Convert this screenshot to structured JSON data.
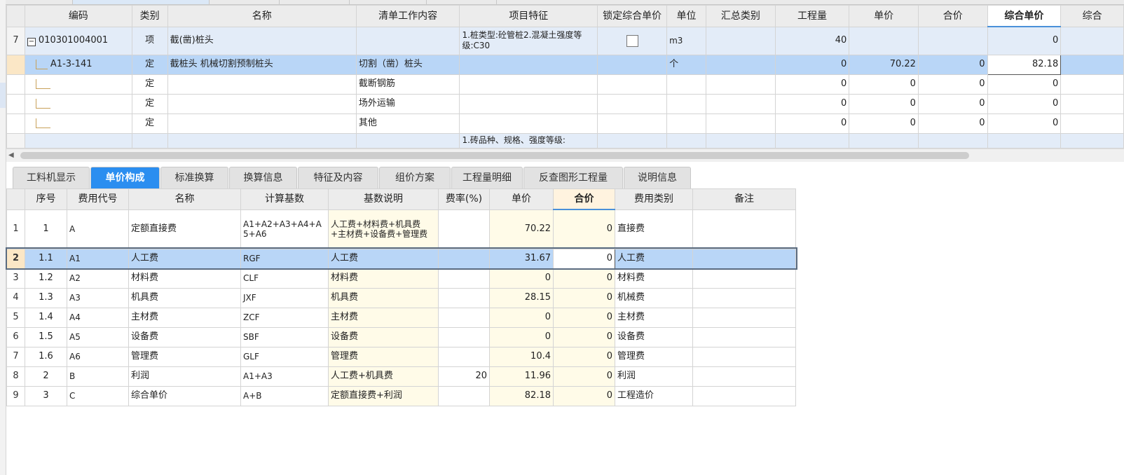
{
  "upper": {
    "headers": [
      "编码",
      "类别",
      "名称",
      "清单工作内容",
      "项目特征",
      "锁定综合单价",
      "单位",
      "汇总类别",
      "工程量",
      "单价",
      "合价",
      "综合单价",
      "综合"
    ],
    "bill_row": {
      "row_no": "7",
      "code": "010301004001",
      "type": "项",
      "name": "截(凿)桩头",
      "content": "",
      "feature": "1.桩类型:砼管桩2.混凝土强度等级:C30",
      "unit": "m3",
      "summary": "",
      "qty": "40",
      "price": "",
      "total": "",
      "unit_price": "0",
      "extra": ""
    },
    "child_rows": [
      {
        "row_no": "",
        "code": "A1-3-141",
        "type": "定",
        "name": "截桩头 机械切割预制桩头",
        "content": "切割（凿）桩头",
        "feature": "",
        "unit": "个",
        "summary": "",
        "qty": "0",
        "price": "70.22",
        "total": "0",
        "unit_price": "82.18"
      },
      {
        "row_no": "",
        "code": "",
        "type": "定",
        "name": "",
        "content": "截断钢筋",
        "feature": "",
        "unit": "",
        "summary": "",
        "qty": "0",
        "price": "0",
        "total": "0",
        "unit_price": "0"
      },
      {
        "row_no": "",
        "code": "",
        "type": "定",
        "name": "",
        "content": "场外运输",
        "feature": "",
        "unit": "",
        "summary": "",
        "qty": "0",
        "price": "0",
        "total": "0",
        "unit_price": "0"
      },
      {
        "row_no": "",
        "code": "",
        "type": "定",
        "name": "",
        "content": "其他",
        "feature": "",
        "unit": "",
        "summary": "",
        "qty": "0",
        "price": "0",
        "total": "0",
        "unit_price": "0"
      }
    ],
    "cut_row": {
      "feature": "1.砖品种、规格、强度等级:"
    }
  },
  "tabs": [
    "工料机显示",
    "单价构成",
    "标准换算",
    "换算信息",
    "特征及内容",
    "组价方案",
    "工程量明细",
    "反查图形工程量",
    "说明信息"
  ],
  "active_tab": "单价构成",
  "lower": {
    "headers": [
      "序号",
      "费用代号",
      "名称",
      "计算基数",
      "基数说明",
      "费率(%)",
      "单价",
      "合价",
      "费用类别",
      "备注"
    ],
    "rows": [
      {
        "rn": "1",
        "seq": "1",
        "code": "A",
        "name": "定额直接费",
        "base": "A1+A2+A3+A4+A5+A6",
        "desc": "人工费+材料费+机具费+主材费+设备费+管理费",
        "rate": "",
        "price": "70.22",
        "total": "0",
        "category": "直接费",
        "note": ""
      },
      {
        "rn": "2",
        "seq": "1.1",
        "code": "A1",
        "name": "人工费",
        "base": "RGF",
        "desc": "人工费",
        "rate": "",
        "price": "31.67",
        "total": "0",
        "category": "人工费",
        "note": ""
      },
      {
        "rn": "3",
        "seq": "1.2",
        "code": "A2",
        "name": "材料费",
        "base": "CLF",
        "desc": "材料费",
        "rate": "",
        "price": "0",
        "total": "0",
        "category": "材料费",
        "note": ""
      },
      {
        "rn": "4",
        "seq": "1.3",
        "code": "A3",
        "name": "机具费",
        "base": "JXF",
        "desc": "机具费",
        "rate": "",
        "price": "28.15",
        "total": "0",
        "category": "机械费",
        "note": ""
      },
      {
        "rn": "5",
        "seq": "1.4",
        "code": "A4",
        "name": "主材费",
        "base": "ZCF",
        "desc": "主材费",
        "rate": "",
        "price": "0",
        "total": "0",
        "category": "主材费",
        "note": ""
      },
      {
        "rn": "6",
        "seq": "1.5",
        "code": "A5",
        "name": "设备费",
        "base": "SBF",
        "desc": "设备费",
        "rate": "",
        "price": "0",
        "total": "0",
        "category": "设备费",
        "note": ""
      },
      {
        "rn": "7",
        "seq": "1.6",
        "code": "A6",
        "name": "管理费",
        "base": "GLF",
        "desc": "管理费",
        "rate": "",
        "price": "10.4",
        "total": "0",
        "category": "管理费",
        "note": ""
      },
      {
        "rn": "8",
        "seq": "2",
        "code": "B",
        "name": "利润",
        "base": "A1+A3",
        "desc": "人工费+机具费",
        "rate": "20",
        "price": "11.96",
        "total": "0",
        "category": "利润",
        "note": ""
      },
      {
        "rn": "9",
        "seq": "3",
        "code": "C",
        "name": "综合单价",
        "base": "A+B",
        "desc": "定额直接费+利润",
        "rate": "",
        "price": "82.18",
        "total": "0",
        "category": "工程造价",
        "note": ""
      }
    ]
  }
}
